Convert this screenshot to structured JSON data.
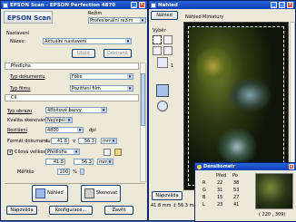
{
  "scan": {
    "title": "EPSON Scan - EPSON Perfection 4870",
    "logo": "EPSON Scan",
    "mode_label": "Režim",
    "mode_value": "Profesionální režim",
    "nastaveni": "Nastavení",
    "nazev_label": "Název:",
    "nazev_value": "Aktuální nastavení",
    "ulozit": "Uložit",
    "odstranit": "Odstranit",
    "predloha": "Předloha",
    "typ_dokumentu_label": "Typ dokumentu",
    "typ_dokumentu_value": "Fólie",
    "typ_filmu_label": "Typ filmu",
    "typ_filmu_value": "Pozitivní film",
    "cil": "Cíl",
    "typ_obrazu_label": "Typ obrazu",
    "typ_obrazu_value": "48bitové barvy",
    "kvalita_label": "Kvalita skenování",
    "kvalita_value": "Nejlepší",
    "rozliseni_label": "Rozlišení",
    "rozliseni_value": "4800",
    "dpi": "dpi",
    "format_label": "Formát dokumentu",
    "sirka": "41.8",
    "vyska": "56.3",
    "jednotka": "mm",
    "cilova_label": "Cílová velikost",
    "cilova_value": "Předloha",
    "cil_sirka": "41.8",
    "cil_vyska": "56.3",
    "meritko_label": "Měřítko",
    "meritko_value": "100",
    "procento": "%",
    "nahled": "Náhled",
    "skenovat": "Skenovat",
    "napoveda": "Nápověda",
    "konfigurace": "Konfigurace...",
    "zavrit": "Zavřít"
  },
  "preview": {
    "title": "Náhled",
    "nahled_btn": "Náhled",
    "tab_nahled": "Náhled",
    "tab_miniatury": "Miniatury",
    "vyber": "Výběr",
    "count": "1",
    "napoveda": "Nápověda",
    "dims": "41.8 mm ↕ 56.3 mm"
  },
  "densitometer": {
    "title": "Densitometr",
    "col_pred": "Před",
    "col_po": "Po",
    "rows": [
      {
        "ch": "R",
        "pred": "22",
        "po": "38"
      },
      {
        "ch": "G",
        "pred": "31",
        "po": "53"
      },
      {
        "ch": "B",
        "pred": "15",
        "po": "27"
      },
      {
        "ch": "L",
        "pred": "23",
        "po": "41"
      }
    ],
    "coords": "( 220 , 309)"
  },
  "colors": {
    "titlebar": "#0a3fb8",
    "desktop": "#3a6ea5",
    "dialog_bg": "#ece9d8"
  }
}
